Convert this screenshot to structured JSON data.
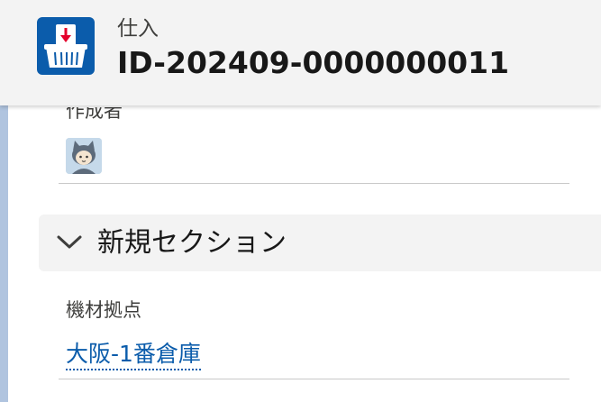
{
  "header": {
    "object_type": "仕入",
    "record_title": "ID-202409-0000000011",
    "icon": "purchase-basket-icon",
    "icon_color": "#0b5cab"
  },
  "fields": {
    "creator": {
      "label": "作成者",
      "avatar": "user-avatar-icon"
    },
    "location": {
      "label": "機材拠点",
      "value": "大阪-1番倉庫",
      "link_color": "#0b5cab"
    }
  },
  "section": {
    "title": "新規セクション",
    "icon": "chevron-down-icon",
    "expanded": true
  }
}
